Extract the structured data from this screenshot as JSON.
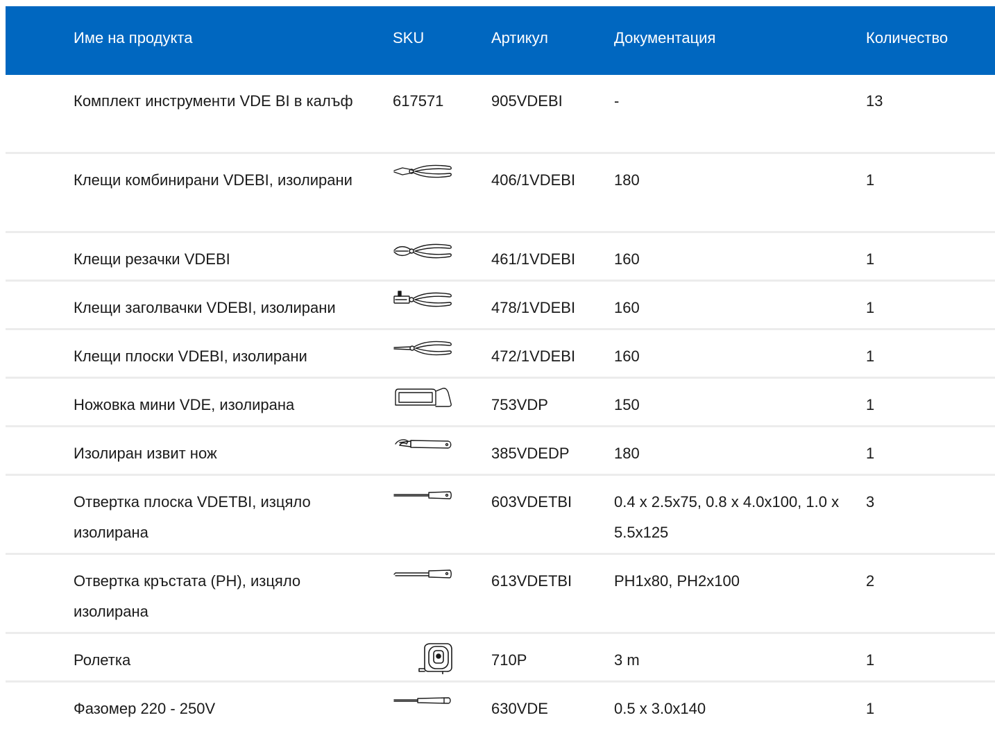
{
  "headers": {
    "name": "Име на продукта",
    "sku": "SKU",
    "article": "Артикул",
    "doc": "Документация",
    "qty": "Количество"
  },
  "rows": [
    {
      "name": "Комплект инструменти VDE BI в калъф",
      "sku": "617571",
      "icon": null,
      "article": "905VDEBI",
      "doc": "-",
      "qty": "13"
    },
    {
      "name": "Клещи комбинирани VDEBI, изолирани",
      "sku": "",
      "icon": "combination-pliers-icon",
      "article": "406/1VDEBI",
      "doc": "180",
      "qty": "1"
    },
    {
      "name": "Клещи резачки VDEBI",
      "sku": "",
      "icon": "side-cutters-icon",
      "article": "461/1VDEBI",
      "doc": "160",
      "qty": "1"
    },
    {
      "name": "Клещи заголвачки VDEBI, изолирани",
      "sku": "",
      "icon": "wire-stripper-icon",
      "article": "478/1VDEBI",
      "doc": "160",
      "qty": "1"
    },
    {
      "name": "Клещи плоски VDEBI, изолирани",
      "sku": "",
      "icon": "flat-nose-pliers-icon",
      "article": "472/1VDEBI",
      "doc": "160",
      "qty": "1"
    },
    {
      "name": "Ножовка мини VDE, изолирана",
      "sku": "",
      "icon": "mini-hacksaw-icon",
      "article": "753VDP",
      "doc": "150",
      "qty": "1"
    },
    {
      "name": "Изолиран извит нож",
      "sku": "",
      "icon": "hooked-knife-icon",
      "article": "385VDEDP",
      "doc": "180",
      "qty": "1"
    },
    {
      "name": "Отвертка плоска VDETBI, изцяло изолирана",
      "sku": "",
      "icon": "flat-screwdriver-icon",
      "article": "603VDETBI",
      "doc": "0.4 x 2.5x75, 0.8 x 4.0x100, 1.0 x 5.5x125",
      "qty": "3"
    },
    {
      "name": "Отвертка кръстата (PH), изцяло изолирана",
      "sku": "",
      "icon": "phillips-screwdriver-icon",
      "article": "613VDETBI",
      "doc": "PH1x80, PH2x100",
      "qty": "2"
    },
    {
      "name": "Ролетка",
      "sku": "",
      "icon": "tape-measure-icon",
      "article": "710P",
      "doc": "3 m",
      "qty": "1"
    },
    {
      "name": "Фазомер 220 - 250V",
      "sku": "",
      "icon": "voltage-tester-icon",
      "article": "630VDE",
      "doc": "0.5 x 3.0x140",
      "qty": "1"
    }
  ],
  "colors": {
    "header_bg": "#0067c0",
    "header_text": "#ffffff",
    "row_divider": "#ececec",
    "text": "#1a1a1a"
  }
}
